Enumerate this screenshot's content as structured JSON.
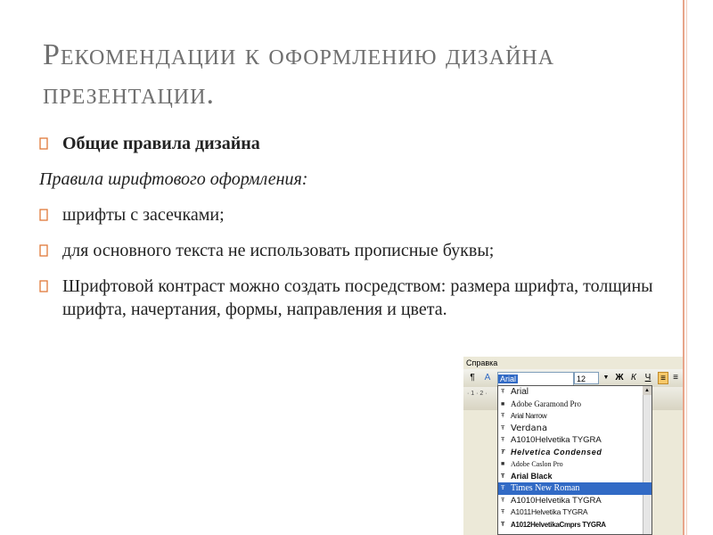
{
  "title": "Рекомендации к оформлению дизайна презентации.",
  "content": {
    "heading": "Общие правила дизайна",
    "subheading": "Правила шрифтового оформления:",
    "bullets": [
      "шрифты с засечками;",
      "для основного текста не использовать прописные буквы;",
      "Шрифтовой контраст можно создать посредством: размера шрифта, толщины шрифта, начертания, формы, направления и цвета."
    ]
  },
  "screenshot": {
    "menu_label": "Справка",
    "font_field_value": "Arial",
    "size_field_value": "12",
    "bold_btn": "Ж",
    "italic_btn": "К",
    "underline_btn": "Ч",
    "ruler_text": "· 1 · 2 ·",
    "fonts": [
      "Arial",
      "Adobe Garamond Pro",
      "Arial Narrow",
      "Verdana",
      "A1010Helvetika TYGRA",
      "Helvetica Condensed",
      "Adobe Caslon Pro",
      "Arial Black",
      "Times New Roman",
      "A1010Helvetika TYGRA",
      "A1011Helvetika TYGRA",
      "A1012HelvetikaCmprs TYGRA"
    ],
    "selected_index": 8
  },
  "colors": {
    "title": "#6f6f6f",
    "accent": "#e8a58a",
    "bullet": "#e07a3a",
    "selection": "#316ac5"
  }
}
